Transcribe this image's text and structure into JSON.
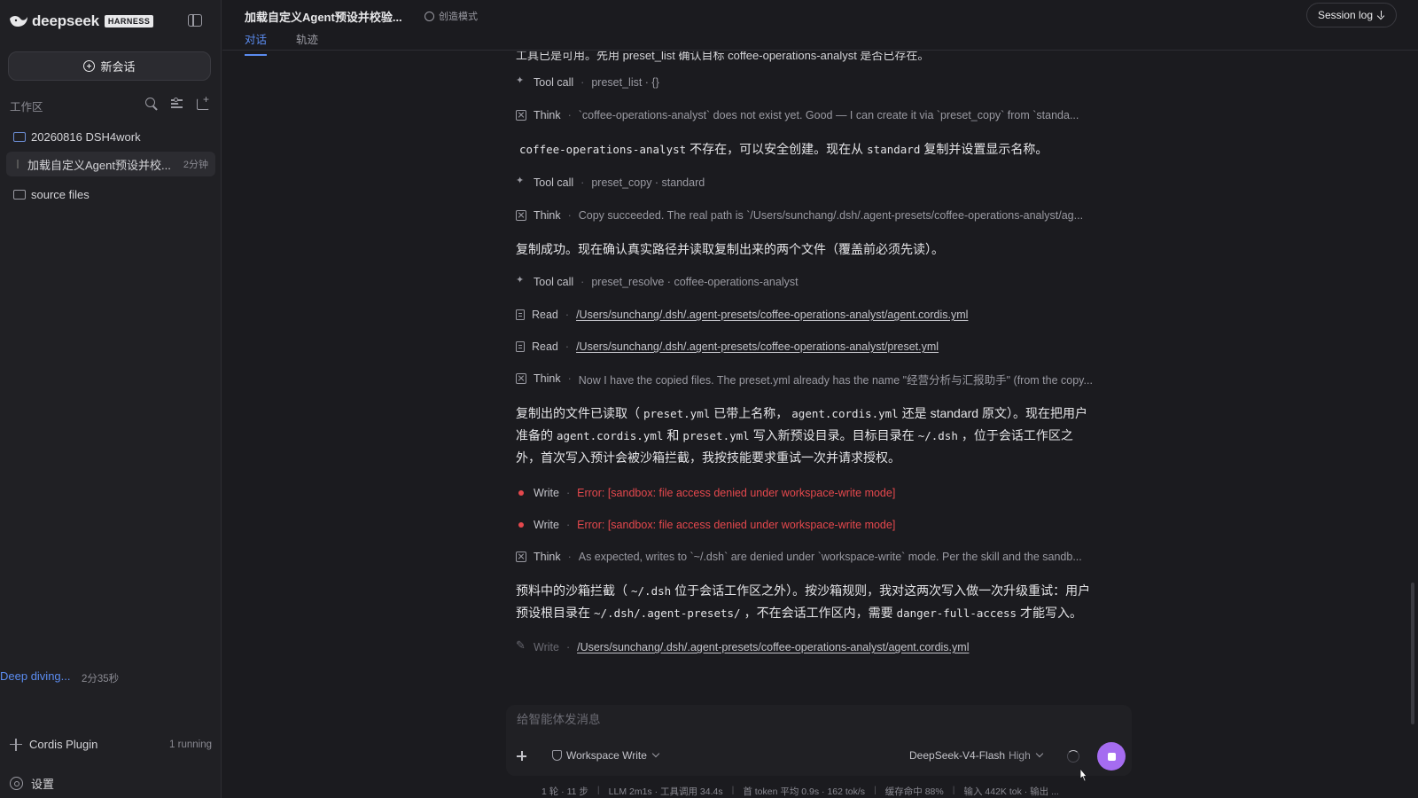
{
  "brand": {
    "name": "deepseek",
    "badge": "HARNESS"
  },
  "sidebar": {
    "new_session": "新会话",
    "workspace_label": "工作区",
    "tree": [
      {
        "label": "20260816 DSH4work",
        "time": ""
      },
      {
        "label": "加载自定义Agent预设并校...",
        "time": "2分钟"
      },
      {
        "label": "source files",
        "time": ""
      }
    ],
    "plugin": {
      "label": "Cordis Plugin",
      "status": "1 running"
    },
    "settings": "设置"
  },
  "header": {
    "title": "加载自定义Agent预设并校验...",
    "mode": "创造模式",
    "tabs": [
      "对话",
      "轨迹"
    ],
    "session_log": "Session log"
  },
  "conversation": {
    "clipped_line": "工具已是可用。先用 preset_list 确认目标 coffee-operations-analyst 是否已存在。",
    "steps": [
      {
        "type": "tool",
        "label": "Tool call",
        "detail": "preset_list · {}"
      },
      {
        "type": "think",
        "label": "Think",
        "detail": "`coffee-operations-analyst` does not exist yet. Good — I can create it via `preset_copy` from `standa..."
      },
      {
        "type": "tool",
        "label": "Tool call",
        "detail": "preset_copy · standard"
      },
      {
        "type": "think",
        "label": "Think",
        "detail": "Copy succeeded. The real path is `/Users/sunchang/.dsh/.agent-presets/coffee-operations-analyst/ag..."
      },
      {
        "type": "tool",
        "label": "Tool call",
        "detail": "preset_resolve · coffee-operations-analyst"
      },
      {
        "type": "read",
        "label": "Read",
        "detail": "/Users/sunchang/.dsh/.agent-presets/coffee-operations-analyst/agent.cordis.yml"
      },
      {
        "type": "read",
        "label": "Read",
        "detail": "/Users/sunchang/.dsh/.agent-presets/coffee-operations-analyst/preset.yml"
      },
      {
        "type": "think",
        "label": "Think",
        "detail": "Now I have the copied files. The preset.yml already has the name \"经营分析与汇报助手\" (from the copy..."
      },
      {
        "type": "error",
        "label": "Write",
        "detail": "Error: [sandbox: file access denied under workspace-write mode]"
      },
      {
        "type": "error",
        "label": "Write",
        "detail": "Error: [sandbox: file access denied under workspace-write mode]"
      },
      {
        "type": "think",
        "label": "Think",
        "detail": "As expected, writes to `~/.dsh` are denied under `workspace-write` mode. Per the skill and the sandb..."
      },
      {
        "type": "pending",
        "label": "Write",
        "detail": "/Users/sunchang/.dsh/.agent-presets/coffee-operations-analyst/agent.cordis.yml"
      }
    ],
    "paragraphs": {
      "p1": {
        "c1": "coffee-operations-analyst",
        "t1": "不存在，可以安全创建。现在从",
        "c2": "standard",
        "t2": "复制并设置显示名称。"
      },
      "p2": "复制成功。现在确认真实路径并读取复制出来的两个文件（覆盖前必须先读）。",
      "p3": {
        "t1": "复制出的文件已读取（",
        "c1": "preset.yml",
        "t2": "已带上名称，",
        "c2": "agent.cordis.yml",
        "t3": "还是 standard 原文）。现在把用户",
        "t4": "准备的",
        "c3": "agent.cordis.yml",
        "t5": "和",
        "c4": "preset.yml",
        "t6": "写入新预设目录。目标目录在",
        "c5": "~/.dsh",
        "t7": "，位于会话工作区之",
        "t8": "外，首次写入预计会被沙箱拦截，我按技能要求重试一次并请求授权。"
      },
      "p4": {
        "t1": "预料中的沙箱拦截（",
        "c1": "~/.dsh",
        "t2": "位于会话工作区之外）。按沙箱规则，我对这两次写入做一次升级重试：用户",
        "t3": "预设根目录在",
        "c2": "~/.dsh/.agent-presets/",
        "t4": "，不在会话工作区内，需要",
        "c3": "danger-full-access",
        "t5": "才能写入。"
      }
    },
    "deep_diving": "Deep diving...",
    "elapsed": "2分35秒"
  },
  "composer": {
    "placeholder": "给智能体发消息",
    "permission": "Workspace Write",
    "model": "DeepSeek-V4-Flash",
    "effort": "High"
  },
  "statusbar": [
    "1 轮 · 11 步",
    "LLM 2m1s · 工具调用 34.4s",
    "首 token 平均 0.9s · 162 tok/s",
    "缓存命中 88%",
    "输入 442K tok · 输出 ..."
  ],
  "colors": {
    "accent": "#5b8cf0",
    "error": "#e5484d",
    "stop_button": "#a56cf0"
  }
}
